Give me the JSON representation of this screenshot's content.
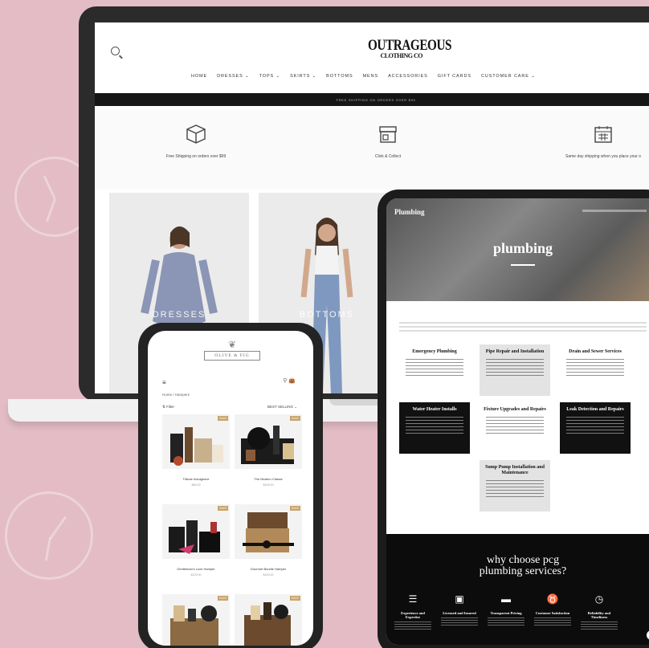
{
  "laptop_site": {
    "logo_line1": "OUTRAGEOUS",
    "logo_line2": "CLOTHING CO",
    "nav": [
      "HOME",
      "DRESSES ⌄",
      "TOPS ⌄",
      "SKIRTS ⌄",
      "BOTTOMS",
      "MENS",
      "ACCESSORIES",
      "GIFT CARDS",
      "CUSTOMER CARE ⌄"
    ],
    "promo": "FREE SHIPPING ON ORDERS OVER $99",
    "features": [
      {
        "icon": "box-icon",
        "label": "Free Shipping on orders over $99"
      },
      {
        "icon": "store-icon",
        "label": "Click & Collect"
      },
      {
        "icon": "calendar-icon",
        "label": "Same day shipping when you place your o"
      }
    ],
    "product_labels": [
      "DRESSES",
      "BOTTOMS"
    ]
  },
  "tablet_site": {
    "brand": "Plumbing",
    "hero_title": "plumbing",
    "services": [
      {
        "title": "Emergency Plumbing",
        "style": "light"
      },
      {
        "title": "Pipe Repair and Installation",
        "style": "gray"
      },
      {
        "title": "Drain and Sewer Services",
        "style": "light"
      },
      {
        "title": "Water Heater Installs",
        "style": "dark"
      },
      {
        "title": "Fixture Upgrades and Repairs",
        "style": "light"
      },
      {
        "title": "Leak Detection and Repairs",
        "style": "dark"
      },
      {
        "title": "Sump Pump Installation and Maintenance",
        "style": "gray"
      }
    ],
    "why_title_line1": "why choose pcg",
    "why_title_line2": "plumbing services?",
    "why_items": [
      {
        "icon": "list-icon",
        "title": "Experience and Expertise"
      },
      {
        "icon": "id-card-icon",
        "title": "Licensed and Insured"
      },
      {
        "icon": "pricing-icon",
        "title": "Transparent Pricing"
      },
      {
        "icon": "medal-icon",
        "title": "Customer Satisfaction"
      },
      {
        "icon": "clock-icon",
        "title": "Reliability and Timeliness"
      }
    ]
  },
  "phone_site": {
    "logo": "OLIVE & FIG",
    "breadcrumb": "Home / Hampers",
    "filter": "Filter",
    "sort": "BEST SELLING ⌄",
    "products": [
      {
        "name": "Tribute Indulgence",
        "price": "$89.00"
      },
      {
        "name": "The Modern Classic",
        "price": "$109.00"
      },
      {
        "name": "Gentleman's Luxe Hamper",
        "price": "$129.00"
      },
      {
        "name": "Gourmet Bundle Hamper",
        "price": "$149.00"
      },
      {
        "name": "",
        "price": ""
      },
      {
        "name": "",
        "price": ""
      }
    ]
  },
  "colors": {
    "background": "#e3bcc6",
    "dark": "#111111",
    "accent": "#c8a46b"
  }
}
